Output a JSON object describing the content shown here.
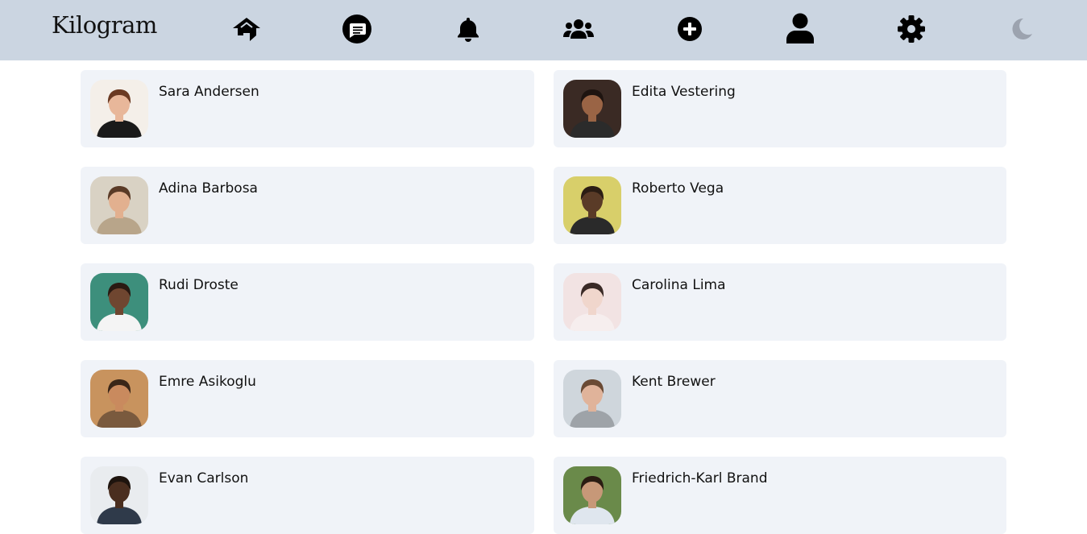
{
  "app": {
    "title": "Kilogram"
  },
  "nav": {
    "items": [
      {
        "icon": "home-icon",
        "label": "Home"
      },
      {
        "icon": "messages-icon",
        "label": "Messages"
      },
      {
        "icon": "bell-icon",
        "label": "Notifications"
      },
      {
        "icon": "users-icon",
        "label": "Friends"
      },
      {
        "icon": "plus-circle-icon",
        "label": "New post"
      },
      {
        "icon": "user-icon",
        "label": "Profile"
      },
      {
        "icon": "gear-icon",
        "label": "Settings"
      },
      {
        "icon": "moon-icon",
        "label": "Dark mode"
      }
    ]
  },
  "colors": {
    "topbar": "#cbd5e1",
    "card": "#f0f3f8",
    "icon": "#000000",
    "moon_icon": "#9ca3af"
  },
  "users": [
    {
      "name": "Sara Andersen",
      "avatar_bg": "#f4efe9",
      "skin": "#e8b79a",
      "hair": "#6b3a22",
      "shirt": "#1a1a1a"
    },
    {
      "name": "Edita Vestering",
      "avatar_bg": "#3a2a24",
      "skin": "#9a6445",
      "hair": "#1e1410",
      "shirt": "#2b2b2b"
    },
    {
      "name": "Adina Barbosa",
      "avatar_bg": "#d9d2c4",
      "skin": "#e2b08f",
      "hair": "#5a3a26",
      "shirt": "#b8a58a"
    },
    {
      "name": "Roberto Vega",
      "avatar_bg": "#d8cf6a",
      "skin": "#5a3b27",
      "hair": "#2b1d14",
      "shirt": "#2a2a2a"
    },
    {
      "name": "Rudi Droste",
      "avatar_bg": "#3d8f7c",
      "skin": "#6f4630",
      "hair": "#2a1a12",
      "shirt": "#f4f4f4"
    },
    {
      "name": "Carolina Lima",
      "avatar_bg": "#f2e3e3",
      "skin": "#f0d6cc",
      "hair": "#3a2a26",
      "shirt": "#f6eeee"
    },
    {
      "name": "Emre Asikoglu",
      "avatar_bg": "#c8935e",
      "skin": "#c98a5e",
      "hair": "#3a2618",
      "shirt": "#7a5a3e"
    },
    {
      "name": "Kent Brewer",
      "avatar_bg": "#cfd6dc",
      "skin": "#e0b39a",
      "hair": "#6a4a34",
      "shirt": "#9ea3a8"
    },
    {
      "name": "Evan Carlson",
      "avatar_bg": "#e9ecef",
      "skin": "#4a2e1f",
      "hair": "#1e140e",
      "shirt": "#2f3a4a"
    },
    {
      "name": "Friedrich-Karl Brand",
      "avatar_bg": "#6a8a4a",
      "skin": "#c79878",
      "hair": "#2a1c12",
      "shirt": "#dfe6ee"
    }
  ]
}
